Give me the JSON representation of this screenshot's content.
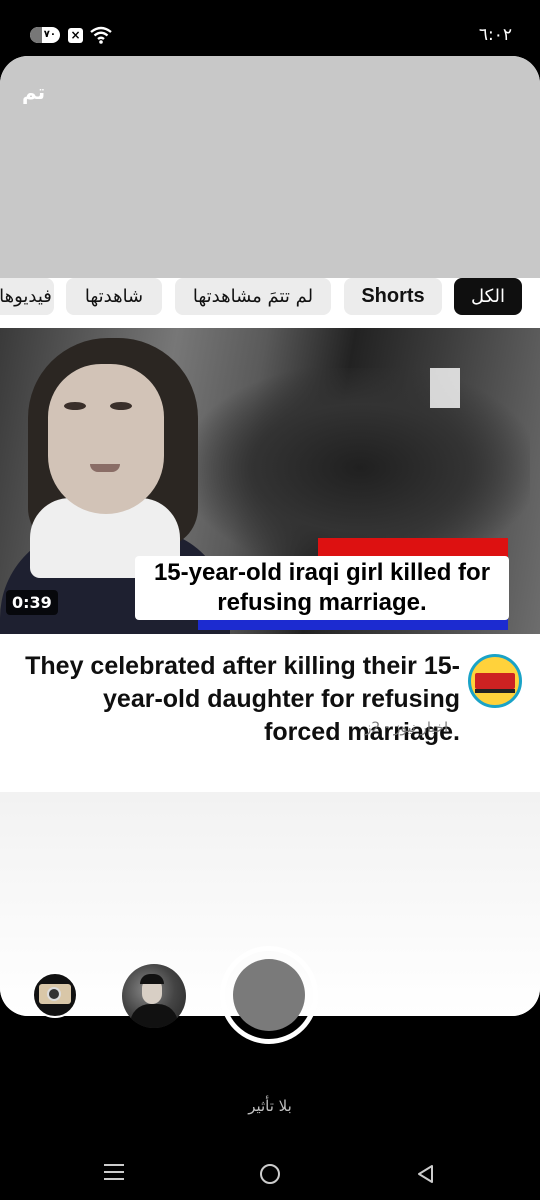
{
  "status_bar": {
    "battery": "٧٠",
    "time": "٦:٠٢",
    "icons": [
      "battery-icon",
      "notification-x-icon",
      "wifi-icon"
    ]
  },
  "sheet": {
    "done_label": "تم"
  },
  "chips": {
    "all": "الكل",
    "shorts": "Shorts",
    "unwatched": "لم تتمَ مشاهدتها",
    "watched": "شاهدتها",
    "videos": "فيديوهات"
  },
  "video": {
    "duration": "0:39",
    "thumbnail_caption": "15-year-old iraqi girl killed for refusing marriage.",
    "title": "They celebrated after killing their 15-year-old daughter for refusing forced marriage.",
    "channel_line": "اخبار نيوز · 2ز"
  },
  "camera": {
    "effect_label": "بلا تأثير"
  },
  "colors": {
    "accent_dark": "#0f0f0f",
    "sheet_header": "#c8c8c8",
    "chip_bg": "#ececec"
  }
}
